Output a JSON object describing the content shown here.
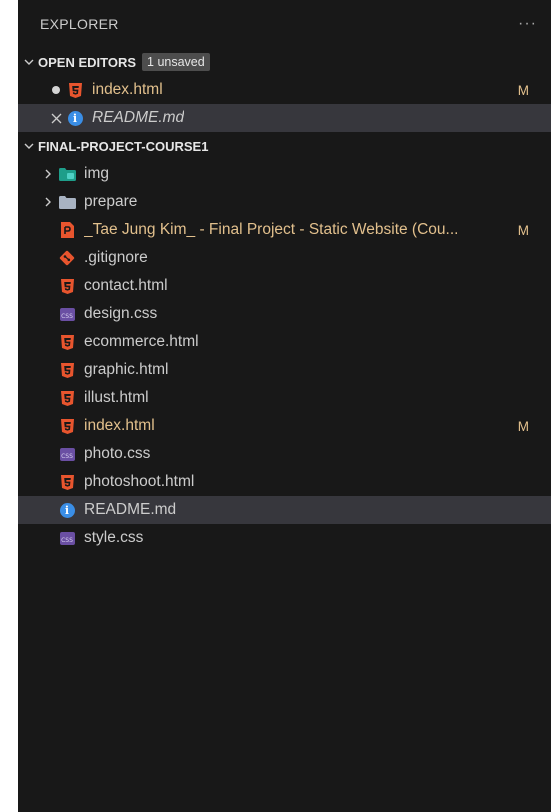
{
  "explorer": {
    "title": "EXPLORER",
    "more": "···"
  },
  "open_editors": {
    "title": "OPEN EDITORS",
    "badge": "1 unsaved",
    "items": [
      {
        "name": "index.html",
        "status": "M"
      },
      {
        "name": "README.md"
      }
    ]
  },
  "project": {
    "title": "FINAL-PROJECT-COURSE1",
    "folders": [
      {
        "name": "img"
      },
      {
        "name": "prepare"
      }
    ],
    "files": [
      {
        "name": "_Tae Jung Kim_ - Final Project - Static Website (Cou...",
        "status": "M"
      },
      {
        "name": ".gitignore"
      },
      {
        "name": "contact.html"
      },
      {
        "name": "design.css"
      },
      {
        "name": "ecommerce.html"
      },
      {
        "name": "graphic.html"
      },
      {
        "name": "illust.html"
      },
      {
        "name": "index.html",
        "status": "M"
      },
      {
        "name": "photo.css"
      },
      {
        "name": "photoshoot.html"
      },
      {
        "name": "README.md"
      },
      {
        "name": "style.css"
      }
    ]
  },
  "colors": {
    "background": "#181818",
    "selected": "#37373d",
    "modified": "#e2c08d",
    "html_icon": "#e8552e",
    "css_icon": "#6a4fa3",
    "info_icon": "#3a8ee6",
    "folder_icon": "#a8b3c2",
    "git_icon": "#e8552e"
  }
}
